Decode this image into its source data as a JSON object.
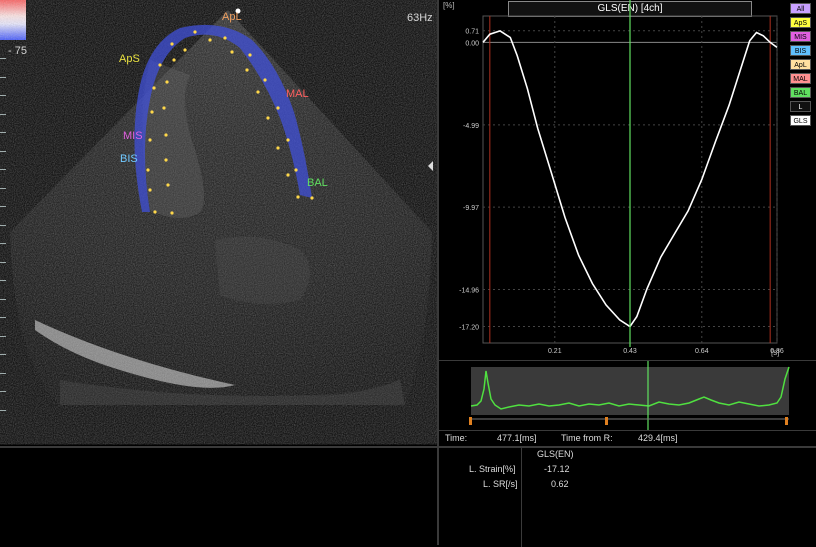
{
  "echo": {
    "scale_value": "- 75",
    "frame_rate": "63Hz",
    "segments": [
      {
        "label": "ApL",
        "color": "#f0a060"
      },
      {
        "label": "ApS",
        "color": "#e8e040"
      },
      {
        "label": "MAL",
        "color": "#ff6060"
      },
      {
        "label": "MIS",
        "color": "#e060e0"
      },
      {
        "label": "BIS",
        "color": "#70c8ff"
      },
      {
        "label": "BAL",
        "color": "#60e060"
      }
    ]
  },
  "chart": {
    "title": "GLS(EN) [4ch]",
    "y_unit": "[%]",
    "x_unit": "[s]",
    "legend": [
      {
        "label": "All",
        "bg": "#c8a0ff",
        "fg": "#000"
      },
      {
        "label": "ApS",
        "bg": "#ffff40",
        "fg": "#000"
      },
      {
        "label": "MIS",
        "bg": "#e060e0",
        "fg": "#000"
      },
      {
        "label": "BIS",
        "bg": "#60c0ff",
        "fg": "#000"
      },
      {
        "label": "ApL",
        "bg": "#ffe0a0",
        "fg": "#000"
      },
      {
        "label": "MAL",
        "bg": "#ff9090",
        "fg": "#000"
      },
      {
        "label": "BAL",
        "bg": "#60e060",
        "fg": "#000"
      },
      {
        "label": "L",
        "bg": "#111111",
        "fg": "#fff"
      },
      {
        "label": "GLS",
        "bg": "#ffffff",
        "fg": "#000"
      }
    ]
  },
  "chart_data": {
    "type": "line",
    "title": "GLS(EN) [4ch]",
    "xlabel": "[s]",
    "ylabel": "[%]",
    "xlim": [
      0,
      0.86
    ],
    "ylim": [
      -18.2,
      1.6
    ],
    "x_ticks": [
      "0.21",
      "0.43",
      "0.64",
      "0.86"
    ],
    "x_tick_values": [
      0.21,
      0.43,
      0.64,
      0.86
    ],
    "y_ticks": [
      "0.71",
      "0.00",
      "-4.99",
      "-9.97",
      "-14.96",
      "-17.20"
    ],
    "y_tick_values": [
      0.71,
      0.0,
      -4.99,
      -9.97,
      -14.96,
      -17.2
    ],
    "grid": true,
    "series": [
      {
        "name": "GLS",
        "color": "#ffffff",
        "x": [
          0.0,
          0.02,
          0.05,
          0.08,
          0.1,
          0.13,
          0.16,
          0.2,
          0.24,
          0.28,
          0.32,
          0.36,
          0.4,
          0.43,
          0.45,
          0.48,
          0.52,
          0.56,
          0.6,
          0.64,
          0.68,
          0.72,
          0.76,
          0.78,
          0.8,
          0.82,
          0.84,
          0.86
        ],
        "y": [
          0.0,
          0.5,
          0.7,
          0.3,
          -0.8,
          -2.8,
          -5.2,
          -7.9,
          -10.6,
          -12.9,
          -14.6,
          -15.9,
          -16.8,
          -17.2,
          -16.6,
          -14.9,
          -13.0,
          -11.6,
          -10.2,
          -8.3,
          -6.0,
          -3.8,
          -1.2,
          0.1,
          0.6,
          0.4,
          0.0,
          -0.3
        ]
      }
    ],
    "cursor_x": 0.43
  },
  "status": {
    "time_label": "Time:",
    "time_value": "477.1[ms]",
    "from_r_label": "Time from R:",
    "from_r_value": "429.4[ms]"
  },
  "table": {
    "column_header": "GLS(EN)",
    "rows": [
      {
        "label": "L. Strain[%]",
        "value": "-17.12"
      },
      {
        "label": "L. SR[/s]",
        "value": "0.62"
      }
    ]
  }
}
